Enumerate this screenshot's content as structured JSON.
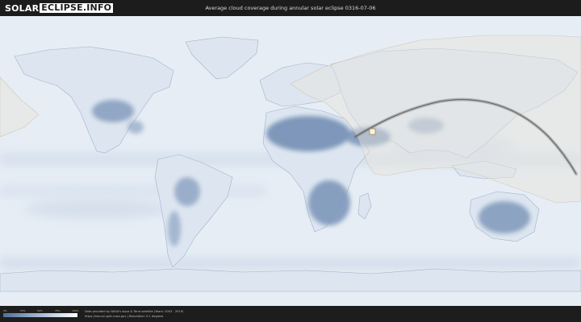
{
  "header": {
    "logo_word1": "SOLAR",
    "logo_word2": "ECLIPSE.INFO",
    "title": "Average cloud coverage during annular solar eclipse 0316-07-06"
  },
  "legend": {
    "ticks": [
      "0%",
      "25%",
      "50%",
      "75%",
      "100%"
    ],
    "colors": [
      "#4f6e98",
      "#8aa2c2",
      "#c4d2e3",
      "#ffffff"
    ]
  },
  "footer": {
    "credit_line1": "Data provided by NASA's Aqua & Terra satellite (Years: 2003 - 2019)",
    "credit_line2": "https://neo.sci.gsfc.nasa.gov  |  Resolution: 0.1 degrees"
  },
  "map": {
    "ocean_color": "#e6edf5",
    "land_cloudy_color": "#dde6f0",
    "land_clear_color": "#7e97ba",
    "eclipse_overlay_color": "#e8e4dc",
    "eclipse_path_color": "#7a7a7a"
  }
}
